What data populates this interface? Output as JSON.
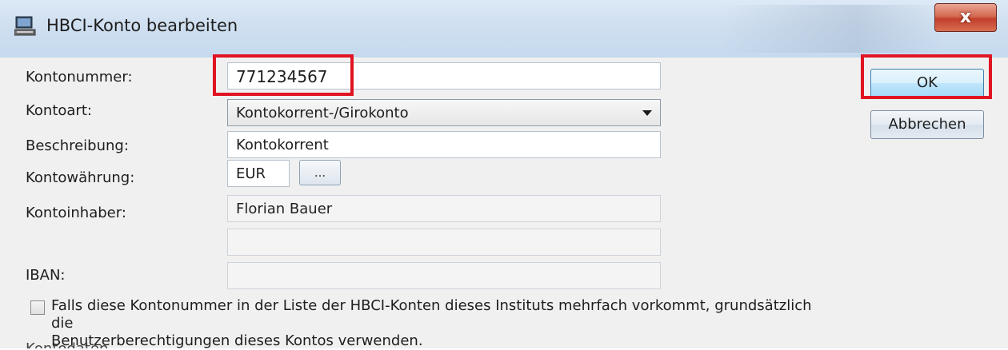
{
  "window": {
    "title": "HBCI-Konto bearbeiten",
    "close_label": "x"
  },
  "form": {
    "kontonummer": {
      "label": "Kontonummer:",
      "value": "771234567"
    },
    "kontoart": {
      "label": "Kontoart:",
      "value": "Kontokorrent-/Girokonto"
    },
    "beschreibung": {
      "label": "Beschreibung:",
      "value": "Kontokorrent"
    },
    "waehrung": {
      "label": "Kontowährung:",
      "value": "EUR",
      "button_label": "..."
    },
    "inhaber": {
      "label": "Kontoinhaber:",
      "value": "Florian Bauer",
      "value2": ""
    },
    "iban": {
      "label": "IBAN:",
      "value": ""
    }
  },
  "checkbox": {
    "checked": false,
    "line1": "Falls diese Kontonummer in der Liste der HBCI-Konten dieses Instituts mehrfach vorkommt, grundsätzlich die",
    "line2": "Benutzerberechtigungen dieses Kontos verwenden."
  },
  "truncated_text": "Kontodaten",
  "buttons": {
    "ok": "OK",
    "cancel": "Abbrechen"
  },
  "colors": {
    "highlight": "#e01423",
    "close_button": "#c2402b",
    "titlebar": "#cfdff0"
  }
}
